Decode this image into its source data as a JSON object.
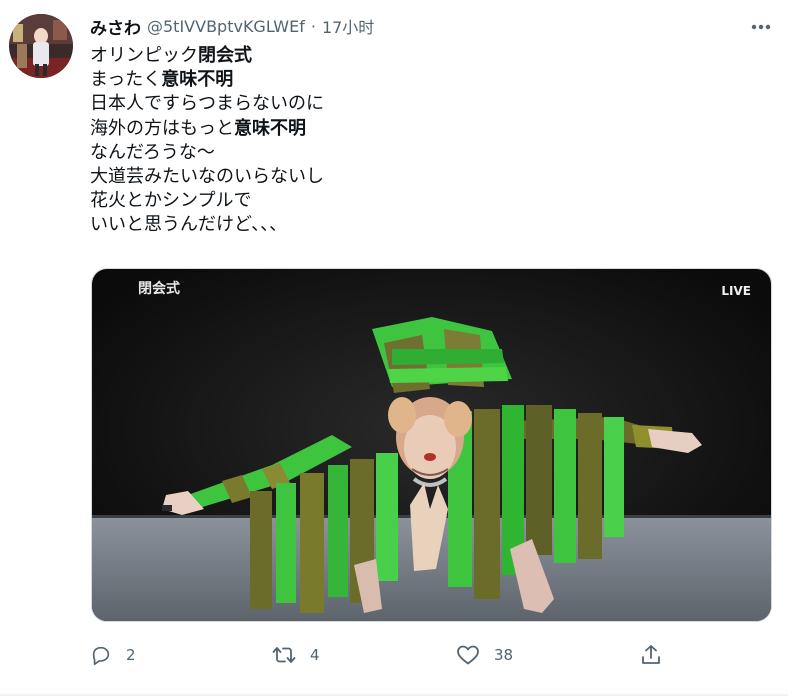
{
  "tweet": {
    "display_name": "みさわ",
    "handle": "@5tIVVBptvKGLWEf",
    "separator": "·",
    "time": "17小时",
    "lines": [
      {
        "pre": "オリンピック",
        "bold": "閉会式",
        "post": ""
      },
      {
        "pre": "まったく",
        "bold": "意味不明",
        "post": ""
      },
      {
        "pre": "日本人ですらつまらないのに",
        "bold": "",
        "post": ""
      },
      {
        "pre": "海外の方はもっと",
        "bold": "意味不明",
        "post": ""
      },
      {
        "pre": "なんだろうな～",
        "bold": "",
        "post": ""
      },
      {
        "pre": "大道芸みたいなのいらないし",
        "bold": "",
        "post": ""
      },
      {
        "pre": "花火とかシンプルで",
        "bold": "",
        "post": ""
      },
      {
        "pre": "いいと思うんだけど、、、",
        "bold": "",
        "post": ""
      }
    ],
    "media": {
      "overlay_title": "閉会式",
      "overlay_live": "LIVE"
    },
    "actions": {
      "reply_count": "2",
      "retweet_count": "4",
      "like_count": "38"
    }
  },
  "icons": {
    "more": "more-horizontal-icon",
    "reply": "reply-icon",
    "retweet": "retweet-icon",
    "like": "heart-icon",
    "share": "share-icon"
  },
  "colors": {
    "text": "#0f1419",
    "secondary": "#536471",
    "border": "#cfd9de",
    "costume_green": "#35c93a",
    "costume_olive": "#6b6b2a"
  }
}
